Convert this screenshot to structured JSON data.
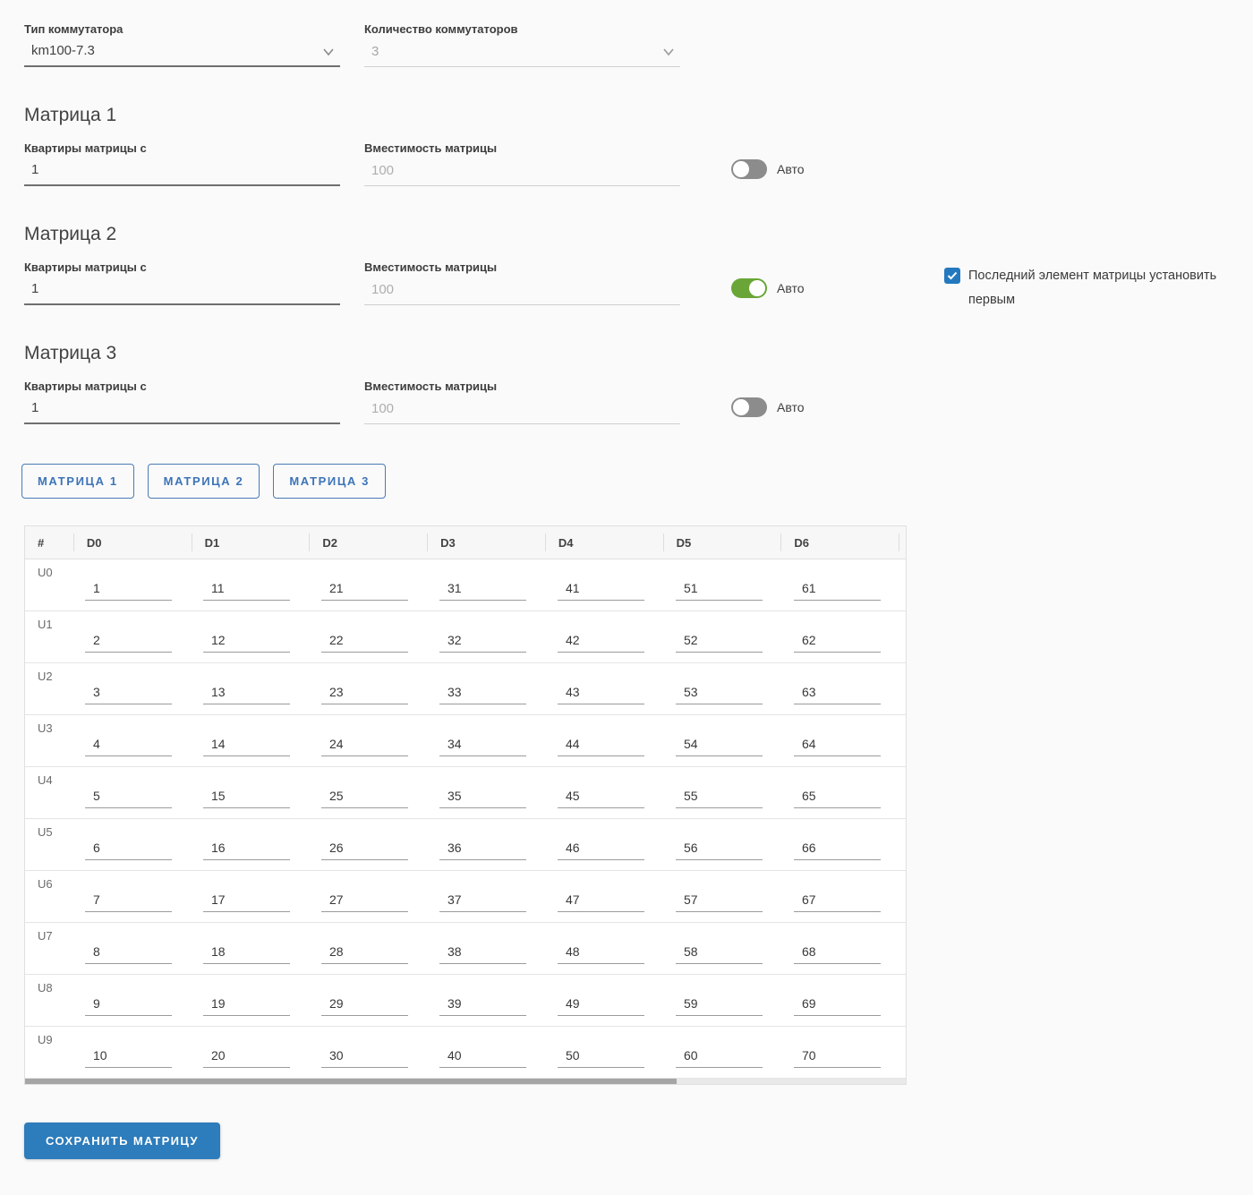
{
  "selects": {
    "switch_type": {
      "label": "Тип коммутатора",
      "value": "km100-7.3",
      "disabled": false
    },
    "switch_count": {
      "label": "Количество коммутаторов",
      "value": "3",
      "disabled": true
    }
  },
  "sections": [
    {
      "title": "Матрица 1",
      "apartments_label": "Квартиры матрицы с",
      "apartments_value": "1",
      "capacity_label": "Вместимость матрицы",
      "capacity_placeholder": "100",
      "auto_label": "Авто",
      "auto_on": false
    },
    {
      "title": "Матрица 2",
      "apartments_label": "Квартиры матрицы с",
      "apartments_value": "1",
      "capacity_label": "Вместимость матрицы",
      "capacity_placeholder": "100",
      "auto_label": "Авто",
      "auto_on": true
    },
    {
      "title": "Матрица 3",
      "apartments_label": "Квартиры матрицы с",
      "apartments_value": "1",
      "capacity_label": "Вместимость матрицы",
      "capacity_placeholder": "100",
      "auto_label": "Авто",
      "auto_on": false
    }
  ],
  "checkbox": {
    "checked": true,
    "label": "Последний элемент матрицы установить первым"
  },
  "tabs": [
    {
      "label": "МАТРИЦА 1"
    },
    {
      "label": "МАТРИЦА 2"
    },
    {
      "label": "МАТРИЦА 3"
    }
  ],
  "matrix_table": {
    "corner": "#",
    "columns": [
      "D0",
      "D1",
      "D2",
      "D3",
      "D4",
      "D5",
      "D6"
    ],
    "rows": [
      {
        "label": "U0",
        "values": [
          1,
          11,
          21,
          31,
          41,
          51,
          61
        ]
      },
      {
        "label": "U1",
        "values": [
          2,
          12,
          22,
          32,
          42,
          52,
          62
        ]
      },
      {
        "label": "U2",
        "values": [
          3,
          13,
          23,
          33,
          43,
          53,
          63
        ]
      },
      {
        "label": "U3",
        "values": [
          4,
          14,
          24,
          34,
          44,
          54,
          64
        ]
      },
      {
        "label": "U4",
        "values": [
          5,
          15,
          25,
          35,
          45,
          55,
          65
        ]
      },
      {
        "label": "U5",
        "values": [
          6,
          16,
          26,
          36,
          46,
          56,
          66
        ]
      },
      {
        "label": "U6",
        "values": [
          7,
          17,
          27,
          37,
          47,
          57,
          67
        ]
      },
      {
        "label": "U7",
        "values": [
          8,
          18,
          28,
          38,
          48,
          58,
          68
        ]
      },
      {
        "label": "U8",
        "values": [
          9,
          19,
          29,
          39,
          49,
          59,
          69
        ]
      },
      {
        "label": "U9",
        "values": [
          10,
          20,
          30,
          40,
          50,
          60,
          70
        ]
      }
    ]
  },
  "save_button": {
    "label": "СОХРАНИТЬ МАТРИЦУ"
  },
  "colors": {
    "accent_blue": "#2d7cbb",
    "tab_blue": "#3d74b8",
    "checkbox_blue": "#2479be",
    "toggle_on_green": "#69a637",
    "toggle_off_gray": "#8c8c8c",
    "page_bg": "#fafafa"
  }
}
